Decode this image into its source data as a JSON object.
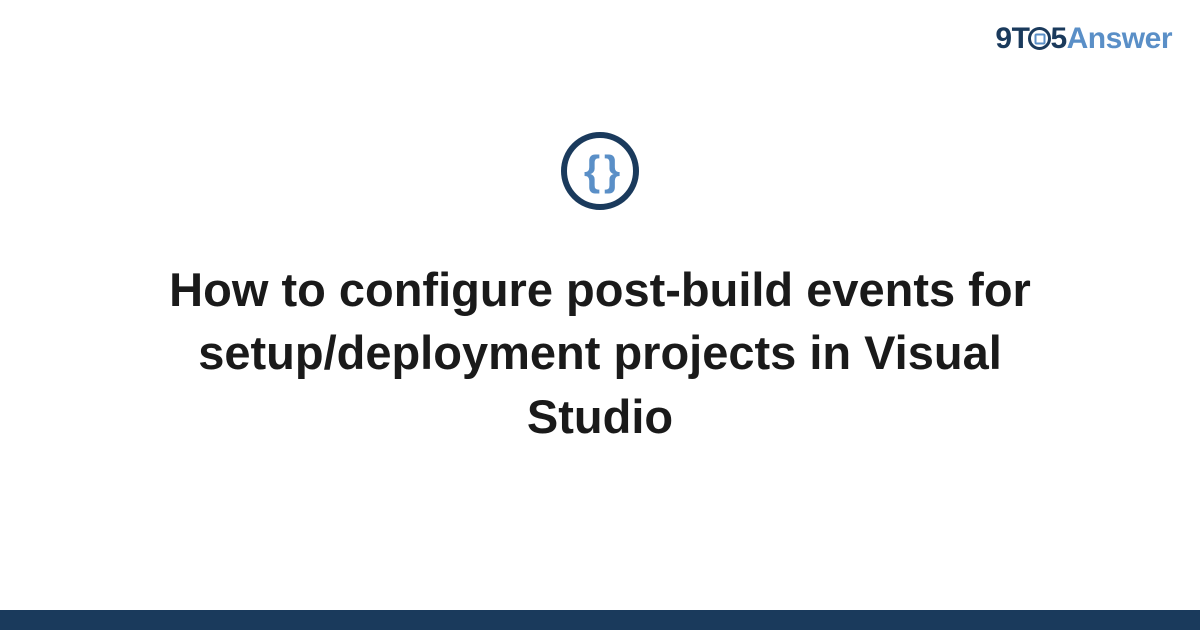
{
  "logo": {
    "prefix": "9T",
    "middle": "5",
    "suffix": "Answer"
  },
  "icon": {
    "name": "code-braces-icon",
    "glyph": "{ }"
  },
  "title": "How to configure post-build events for setup/deployment projects in Visual Studio",
  "colors": {
    "primary": "#1a3a5c",
    "accent": "#5a8fc7"
  }
}
